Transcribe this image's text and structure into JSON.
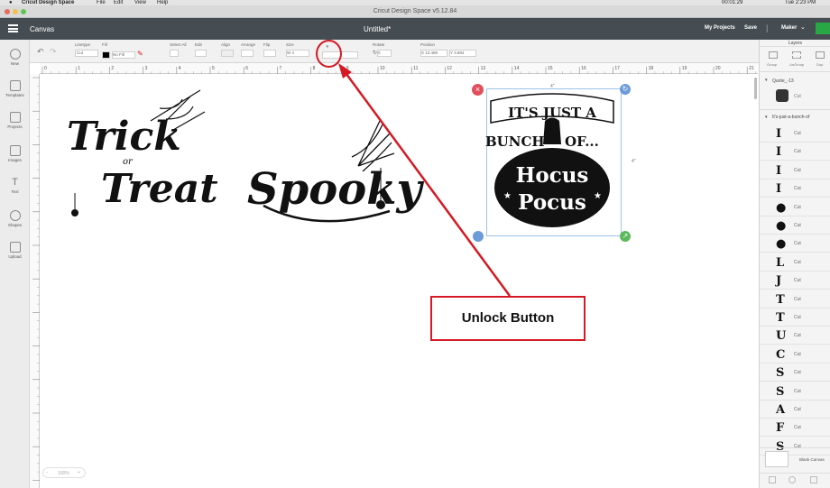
{
  "mac_menu": {
    "app": "Cricut Design Space",
    "items": [
      "File",
      "Edit",
      "View",
      "Help"
    ],
    "right_time": "00:01:29",
    "clock": "Tue 2:23 PM"
  },
  "window_title": "Cricut Design Space  v5.12.84",
  "header": {
    "canvas_label": "Canvas",
    "doc_title": "Untitled*",
    "my_projects": "My Projects",
    "save": "Save",
    "machine": "Maker"
  },
  "toolbar": {
    "linetype_label": "Linetype",
    "linetype_value": "Cut",
    "fill_label": "Fill",
    "fill_value": "No Fill",
    "select_all": "Select All",
    "edit": "Edit",
    "align": "Align",
    "arrange": "Arrange",
    "flip": "Flip",
    "size": "Size",
    "size_w": "W 4",
    "rotate": "Rotate",
    "rotate_value": "0",
    "position": "Position",
    "pos_x": "X 13.469",
    "pos_y": "Y 3.884"
  },
  "ruler_ticks": [
    "0",
    "1",
    "2",
    "3",
    "4",
    "5",
    "6",
    "7",
    "8",
    "9",
    "10",
    "11",
    "12",
    "13",
    "14",
    "15",
    "16",
    "17",
    "18",
    "19",
    "20",
    "21"
  ],
  "left_tools": [
    "New",
    "Templates",
    "Projects",
    "Images",
    "Text",
    "Shapes",
    "Upload"
  ],
  "designs": {
    "trick": {
      "l1": "Trick",
      "l2": "or",
      "l3": "Treat"
    },
    "spooky": {
      "l1": "Spooky"
    },
    "hocus": {
      "l1": "IT'S JUST A",
      "l2": "BUNCH",
      "l3": "OF...",
      "l4": "Hocus",
      "l5": "Pocus",
      "w": "4\"",
      "h": "4\""
    }
  },
  "layers": {
    "title": "Layers",
    "tools": [
      "Group",
      "UnGroup",
      "Dup"
    ],
    "group1": "Quote_-13",
    "group2": "It's-just-a-bunch-of",
    "row_label": "Cut",
    "blank_canvas": "Blank Canvas",
    "glyphs": [
      "I",
      "I",
      "I",
      "I",
      "●",
      "●",
      "●",
      "L",
      "J",
      "T",
      "T",
      "U",
      "C",
      "S",
      "S",
      "A",
      "F",
      "S"
    ]
  },
  "zoom": "100%",
  "annotation": {
    "label": "Unlock Button"
  },
  "colors": {
    "accent": "#d41a24",
    "header": "#464d52",
    "go": "#28a745",
    "sel": "#9ec3e6"
  }
}
